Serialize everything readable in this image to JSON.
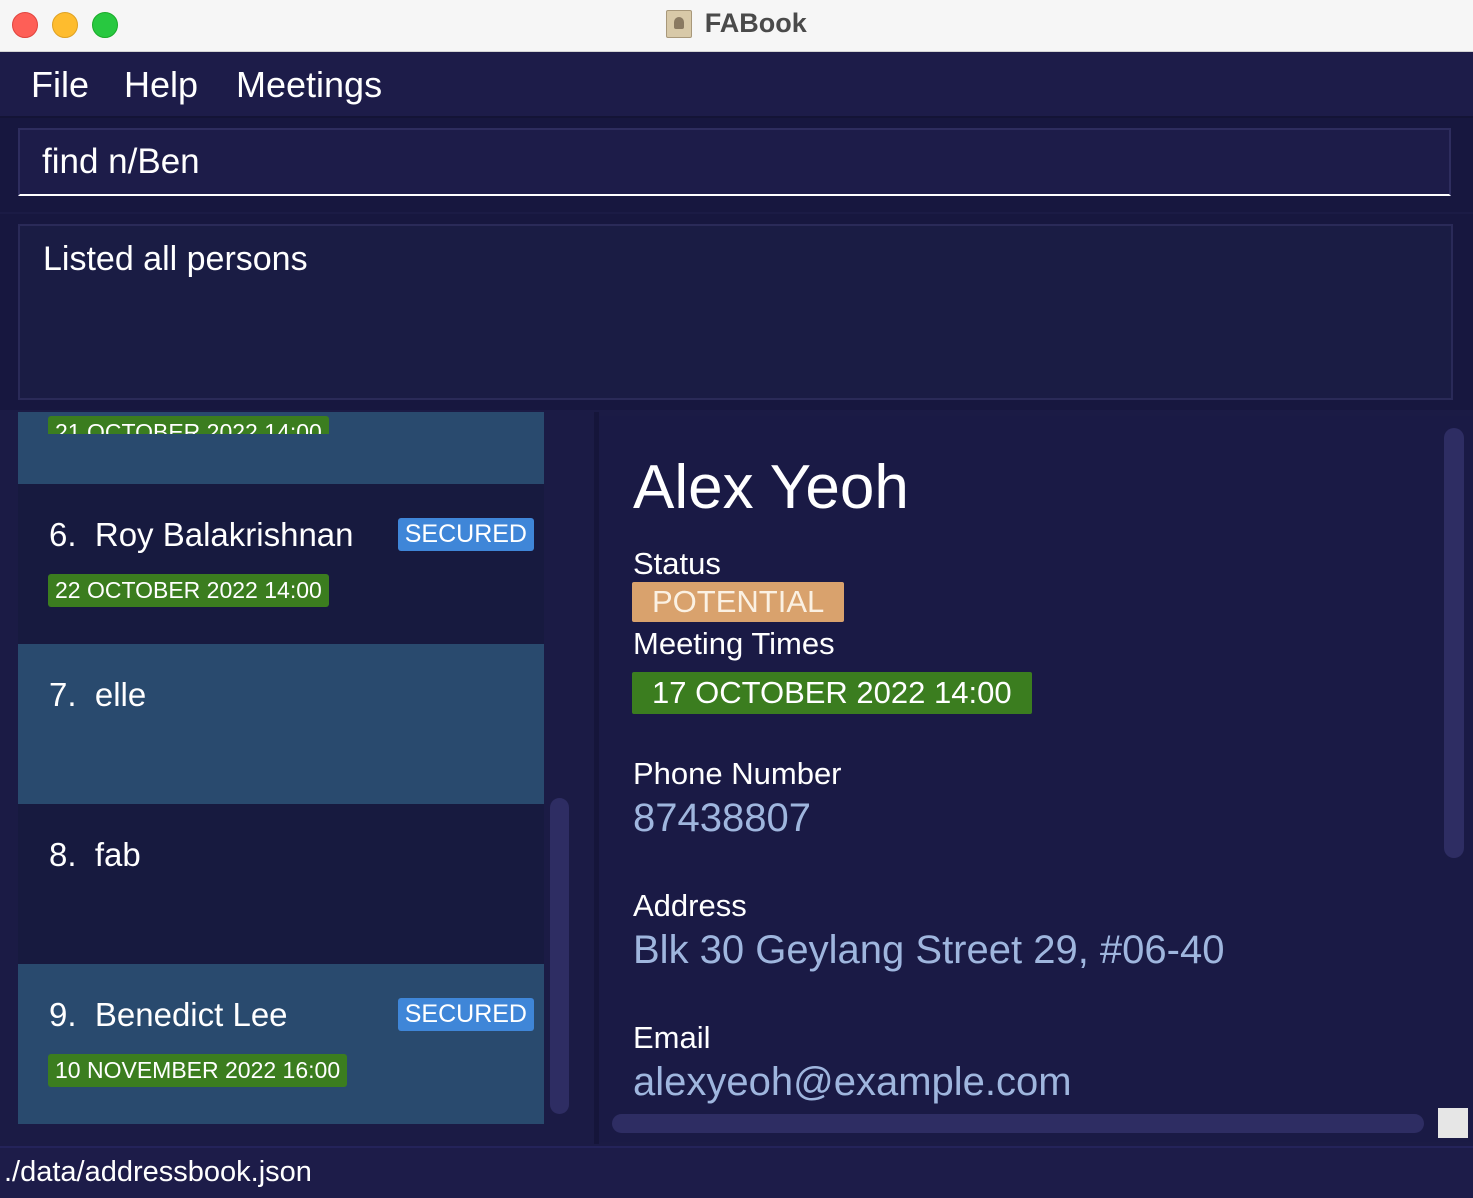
{
  "window": {
    "title": "FABook",
    "app_icon": "address-book-icon"
  },
  "menu": {
    "items": [
      "File",
      "Help",
      "Meetings"
    ]
  },
  "command": {
    "value": "find n/Ben"
  },
  "result": {
    "message": "Listed all persons"
  },
  "person_list": {
    "partial_card_meeting": "21 OCTOBER 2022 14:00",
    "cards": [
      {
        "index": "6.",
        "name": "Roy Balakrishnan",
        "badge": "SECURED",
        "meeting": "22 OCTOBER 2022 14:00"
      },
      {
        "index": "7.",
        "name": "elle"
      },
      {
        "index": "8.",
        "name": "fab"
      },
      {
        "index": "9.",
        "name": "Benedict Lee",
        "badge": "SECURED",
        "meeting": "10 NOVEMBER 2022 16:00"
      }
    ]
  },
  "detail": {
    "name": "Alex Yeoh",
    "status_label": "Status",
    "status_value": "POTENTIAL",
    "meeting_label": "Meeting Times",
    "meeting_value": "17 OCTOBER 2022 14:00",
    "phone_label": "Phone Number",
    "phone_value": "87438807",
    "address_label": "Address",
    "address_value": "Blk 30 Geylang Street 29, #06-40",
    "email_label": "Email",
    "email_value": "alexyeoh@example.com"
  },
  "statusbar": {
    "file_path": "./data/addressbook.json"
  },
  "colors": {
    "background": "#1b1b45",
    "secured_badge": "#3f86d8",
    "meeting_badge": "#3b7d1f",
    "potential_badge": "#d9a26d",
    "card_light": "#294a6e",
    "card_dark": "#171a3f"
  }
}
